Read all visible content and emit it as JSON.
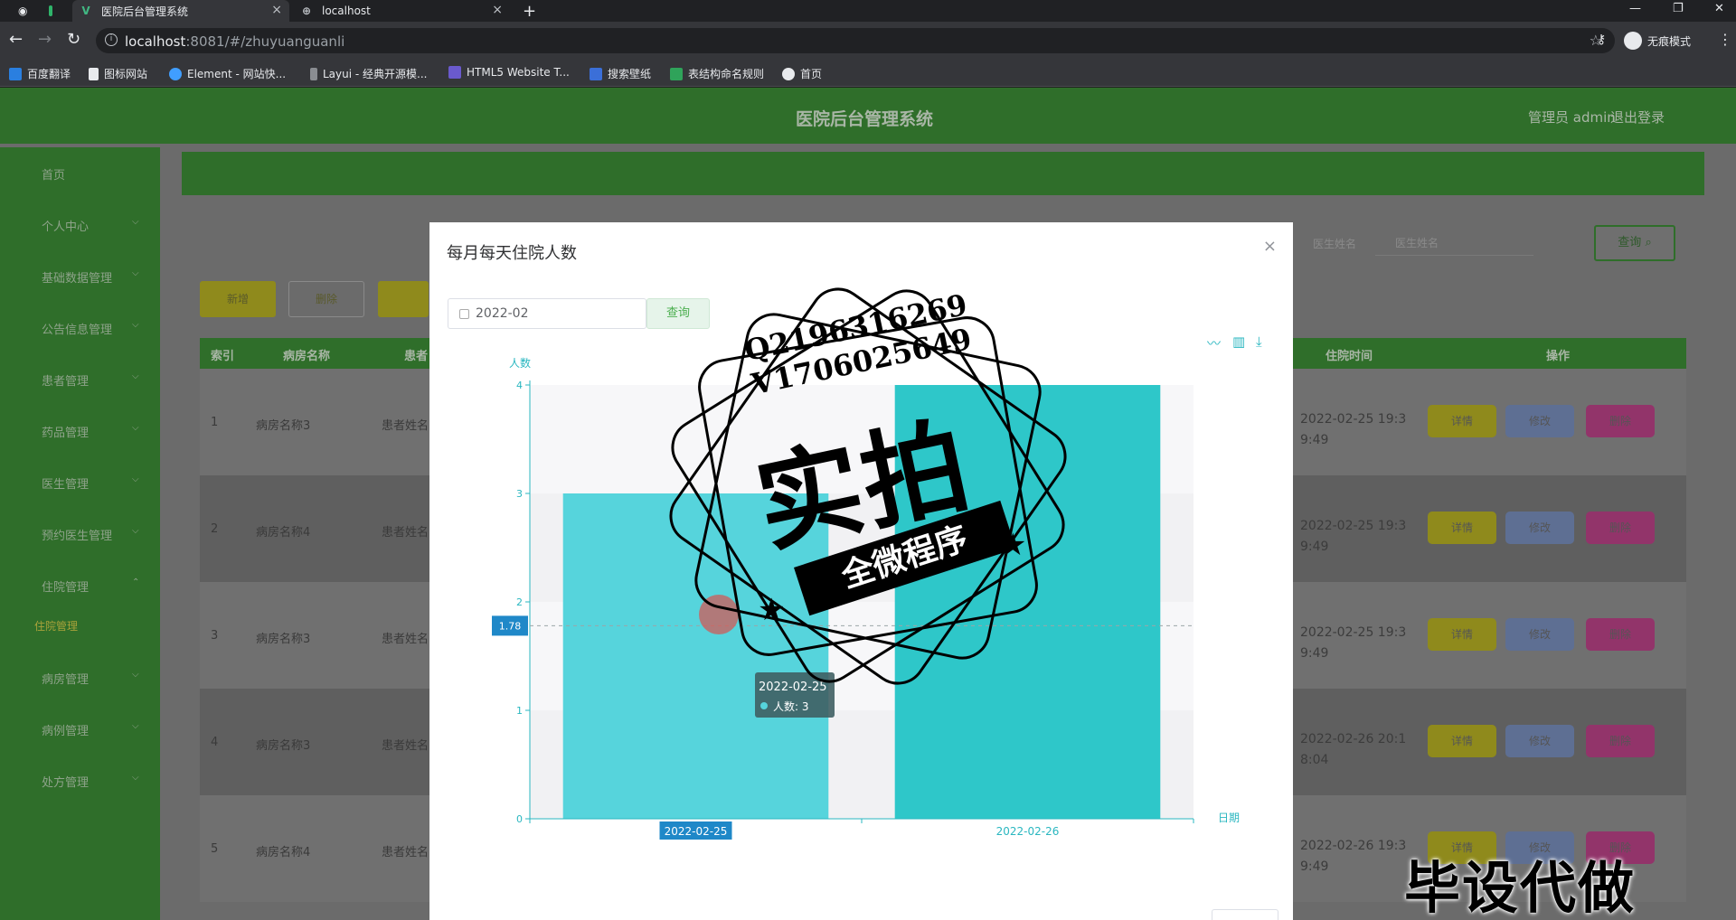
{
  "browser": {
    "tabs": [
      {
        "title": "医院后台管理系统",
        "active": true
      },
      {
        "title": "localhost",
        "active": false
      }
    ],
    "url_host": "localhost",
    "url_path": ":8081/#/zhuyuanguanli",
    "incognito_label": "无痕模式",
    "bookmarks": [
      "百度翻译",
      "图标网站",
      "Element - 网站快...",
      "Layui - 经典开源模...",
      "HTML5 Website T...",
      "搜索壁纸",
      "表结构命名规则",
      "首页"
    ]
  },
  "app": {
    "title": "医院后台管理系统",
    "user": "管理员 admin",
    "logout": "退出登录",
    "sidebar": [
      {
        "label": "首页",
        "chevron": false
      },
      {
        "label": "个人中心",
        "chevron": true
      },
      {
        "label": "基础数据管理",
        "chevron": true
      },
      {
        "label": "公告信息管理",
        "chevron": true
      },
      {
        "label": "患者管理",
        "chevron": true
      },
      {
        "label": "药品管理",
        "chevron": true
      },
      {
        "label": "医生管理",
        "chevron": true
      },
      {
        "label": "预约医生管理",
        "chevron": true
      },
      {
        "label": "住院管理",
        "chevron": true
      },
      {
        "label": "住院管理",
        "chevron": false,
        "sub": true
      },
      {
        "label": "病房管理",
        "chevron": true
      },
      {
        "label": "病例管理",
        "chevron": true
      },
      {
        "label": "处方管理",
        "chevron": true
      }
    ],
    "search": {
      "label": "医生姓名",
      "placeholder": "医生姓名",
      "button": "查询"
    },
    "toolbar": {
      "add": "新增",
      "delete": "删除"
    },
    "table": {
      "headers": [
        "索引",
        "病房名称",
        "患者",
        "住院时间",
        "操作"
      ],
      "rows": [
        {
          "index": "1",
          "room": "病房名称3",
          "patient": "患者姓名",
          "time1": "2022-02-25 19:3",
          "time2": "9:49"
        },
        {
          "index": "2",
          "room": "病房名称4",
          "patient": "患者姓名",
          "time1": "2022-02-25 19:3",
          "time2": "9:49"
        },
        {
          "index": "3",
          "room": "病房名称3",
          "patient": "患者姓名",
          "time1": "2022-02-25 19:3",
          "time2": "9:49"
        },
        {
          "index": "4",
          "room": "病房名称3",
          "patient": "患者姓名",
          "time1": "2022-02-26 20:1",
          "time2": "8:04"
        },
        {
          "index": "5",
          "room": "病房名称4",
          "patient": "患者姓名",
          "time1": "2022-02-26 19:3",
          "time2": "9:49"
        }
      ],
      "actions": {
        "detail": "详情",
        "edit": "修改",
        "delete": "删除"
      }
    }
  },
  "dialog": {
    "title": "每月每天住院人数",
    "date_value": "2022-02",
    "query_label": "查询"
  },
  "chart_data": {
    "type": "bar",
    "categories": [
      "2022-02-25",
      "2022-02-26"
    ],
    "series": [
      {
        "name": "人数",
        "values": [
          3,
          4
        ]
      }
    ],
    "ylabel": "人数",
    "xlabel": "日期",
    "ylim": [
      0,
      4
    ],
    "yticks": [
      0,
      1,
      2,
      3,
      4
    ],
    "colors": [
      "#56d4dc",
      "#2ec7c9"
    ],
    "axis_pointer_value": "1.78",
    "tooltip": {
      "title": "2022-02-25",
      "text": "人数: 3"
    }
  },
  "watermark": {
    "contact_q": "Q2196316269",
    "contact_v": "V1706025649",
    "big": "实拍",
    "banner": "全微程序",
    "corner": "毕设代做"
  }
}
